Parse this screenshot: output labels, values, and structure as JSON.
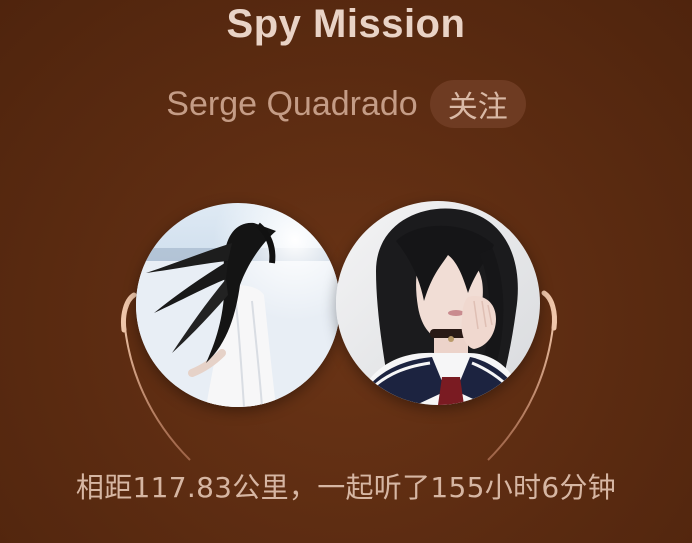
{
  "song": {
    "title": "Spy Mission"
  },
  "artist": {
    "name": "Serge Quadrado",
    "follow_label": "关注"
  },
  "avatars": {
    "left": "user-avatar-1",
    "right": "user-avatar-2"
  },
  "stats": {
    "text": "相距117.83公里，一起听了155小时6分钟"
  },
  "colors": {
    "background": "#5a2a10",
    "title": "#e9d3c6",
    "artist": "#c49c86",
    "follow_bg": "#6e3b22",
    "wire": "#e6b79a"
  }
}
